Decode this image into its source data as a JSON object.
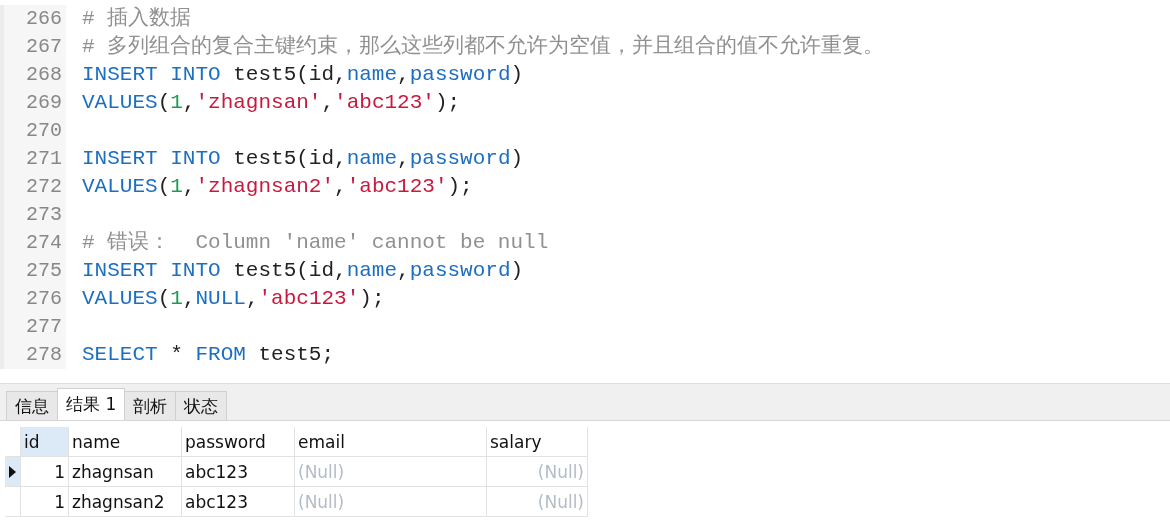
{
  "editor": {
    "lines": [
      {
        "number": "266",
        "tokens": [
          {
            "kind": "comment",
            "text": "# 插入数据"
          }
        ]
      },
      {
        "number": "267",
        "tokens": [
          {
            "kind": "comment",
            "text": "# 多列组合的复合主键约束，那么这些列都不允许为空值，并且组合的值不允许重复。"
          }
        ]
      },
      {
        "number": "268",
        "tokens": [
          {
            "kind": "keyword",
            "text": "INSERT INTO"
          },
          {
            "kind": "plain",
            "text": " test5(id,"
          },
          {
            "kind": "keyword",
            "text": "name"
          },
          {
            "kind": "plain",
            "text": ","
          },
          {
            "kind": "keyword",
            "text": "password"
          },
          {
            "kind": "plain",
            "text": ")"
          }
        ]
      },
      {
        "number": "269",
        "tokens": [
          {
            "kind": "keyword",
            "text": "VALUES"
          },
          {
            "kind": "plain",
            "text": "("
          },
          {
            "kind": "number",
            "text": "1"
          },
          {
            "kind": "plain",
            "text": ","
          },
          {
            "kind": "string",
            "text": "'zhagnsan'"
          },
          {
            "kind": "plain",
            "text": ","
          },
          {
            "kind": "string",
            "text": "'abc123'"
          },
          {
            "kind": "plain",
            "text": ");"
          }
        ]
      },
      {
        "number": "270"
      },
      {
        "number": "271",
        "tokens": [
          {
            "kind": "keyword",
            "text": "INSERT INTO"
          },
          {
            "kind": "plain",
            "text": " test5(id,"
          },
          {
            "kind": "keyword",
            "text": "name"
          },
          {
            "kind": "plain",
            "text": ","
          },
          {
            "kind": "keyword",
            "text": "password"
          },
          {
            "kind": "plain",
            "text": ")"
          }
        ]
      },
      {
        "number": "272",
        "tokens": [
          {
            "kind": "keyword",
            "text": "VALUES"
          },
          {
            "kind": "plain",
            "text": "("
          },
          {
            "kind": "number",
            "text": "1"
          },
          {
            "kind": "plain",
            "text": ","
          },
          {
            "kind": "string",
            "text": "'zhagnsan2'"
          },
          {
            "kind": "plain",
            "text": ","
          },
          {
            "kind": "string",
            "text": "'abc123'"
          },
          {
            "kind": "plain",
            "text": ");"
          }
        ]
      },
      {
        "number": "273"
      },
      {
        "number": "274",
        "tokens": [
          {
            "kind": "comment",
            "text": "# 错误：  Column 'name' cannot be null"
          }
        ]
      },
      {
        "number": "275",
        "tokens": [
          {
            "kind": "keyword",
            "text": "INSERT INTO"
          },
          {
            "kind": "plain",
            "text": " test5(id,"
          },
          {
            "kind": "keyword",
            "text": "name"
          },
          {
            "kind": "plain",
            "text": ","
          },
          {
            "kind": "keyword",
            "text": "password"
          },
          {
            "kind": "plain",
            "text": ")"
          }
        ]
      },
      {
        "number": "276",
        "tokens": [
          {
            "kind": "keyword",
            "text": "VALUES"
          },
          {
            "kind": "plain",
            "text": "("
          },
          {
            "kind": "number",
            "text": "1"
          },
          {
            "kind": "plain",
            "text": ","
          },
          {
            "kind": "keyword",
            "text": "NULL"
          },
          {
            "kind": "plain",
            "text": ","
          },
          {
            "kind": "string",
            "text": "'abc123'"
          },
          {
            "kind": "plain",
            "text": ");"
          }
        ]
      },
      {
        "number": "277"
      },
      {
        "number": "278",
        "tokens": [
          {
            "kind": "keyword",
            "text": "SELECT"
          },
          {
            "kind": "plain",
            "text": " * "
          },
          {
            "kind": "keyword",
            "text": "FROM"
          },
          {
            "kind": "plain",
            "text": " test5;"
          }
        ]
      }
    ]
  },
  "tabs": [
    {
      "label": "信息",
      "selected": false
    },
    {
      "label": "结果 1",
      "selected": true
    },
    {
      "label": "剖析",
      "selected": false
    },
    {
      "label": "状态",
      "selected": false
    }
  ],
  "table": {
    "columns": [
      {
        "label": "id",
        "selected": true,
        "numeric": true
      },
      {
        "label": "name",
        "selected": false,
        "numeric": false
      },
      {
        "label": "password",
        "selected": false,
        "numeric": false
      },
      {
        "label": "email",
        "selected": false,
        "numeric": false
      },
      {
        "label": "salary",
        "selected": false,
        "numeric": true
      }
    ],
    "rows": [
      {
        "current": true,
        "cells": [
          {
            "text": "1",
            "null": false
          },
          {
            "text": "zhagnsan",
            "null": false
          },
          {
            "text": "abc123",
            "null": false
          },
          {
            "text": "(Null)",
            "null": true
          },
          {
            "text": "(Null)",
            "null": true
          }
        ]
      },
      {
        "current": false,
        "cells": [
          {
            "text": "1",
            "null": false
          },
          {
            "text": "zhagnsan2",
            "null": false
          },
          {
            "text": "abc123",
            "null": false
          },
          {
            "text": "(Null)",
            "null": true
          },
          {
            "text": "(Null)",
            "null": true
          }
        ]
      }
    ]
  }
}
